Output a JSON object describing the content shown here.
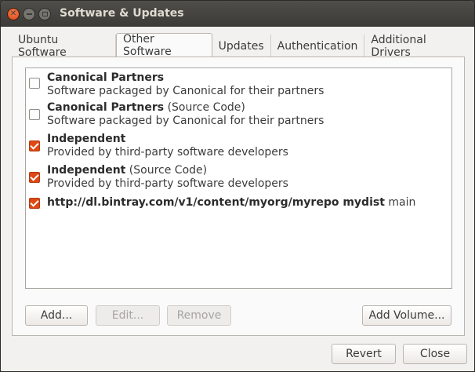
{
  "window": {
    "title": "Software & Updates"
  },
  "tabs": [
    {
      "label": "Ubuntu Software",
      "active": false
    },
    {
      "label": "Other Software",
      "active": true
    },
    {
      "label": "Updates",
      "active": false
    },
    {
      "label": "Authentication",
      "active": false
    },
    {
      "label": "Additional Drivers",
      "active": false
    }
  ],
  "sources": [
    {
      "name": "Canonical Partners",
      "suffix": "",
      "desc": "Software packaged by Canonical for their partners",
      "checked": false
    },
    {
      "name": "Canonical Partners",
      "suffix": " (Source Code)",
      "desc": "Software packaged by Canonical for their partners",
      "checked": false
    },
    {
      "name": "Independent",
      "suffix": "",
      "desc": "Provided by third-party software developers",
      "checked": true
    },
    {
      "name": "Independent",
      "suffix": " (Source Code)",
      "desc": "Provided by third-party software developers",
      "checked": true
    },
    {
      "name": "http://dl.bintray.com/v1/content/myorg/myrepo mydist",
      "suffix": " main",
      "desc": "",
      "checked": true
    }
  ],
  "buttons": {
    "add": "Add...",
    "edit": "Edit...",
    "remove": "Remove",
    "add_volume": "Add Volume...",
    "revert": "Revert",
    "close": "Close"
  },
  "colors": {
    "accent": "#dd4814",
    "titlebar": "#3c3b37"
  }
}
